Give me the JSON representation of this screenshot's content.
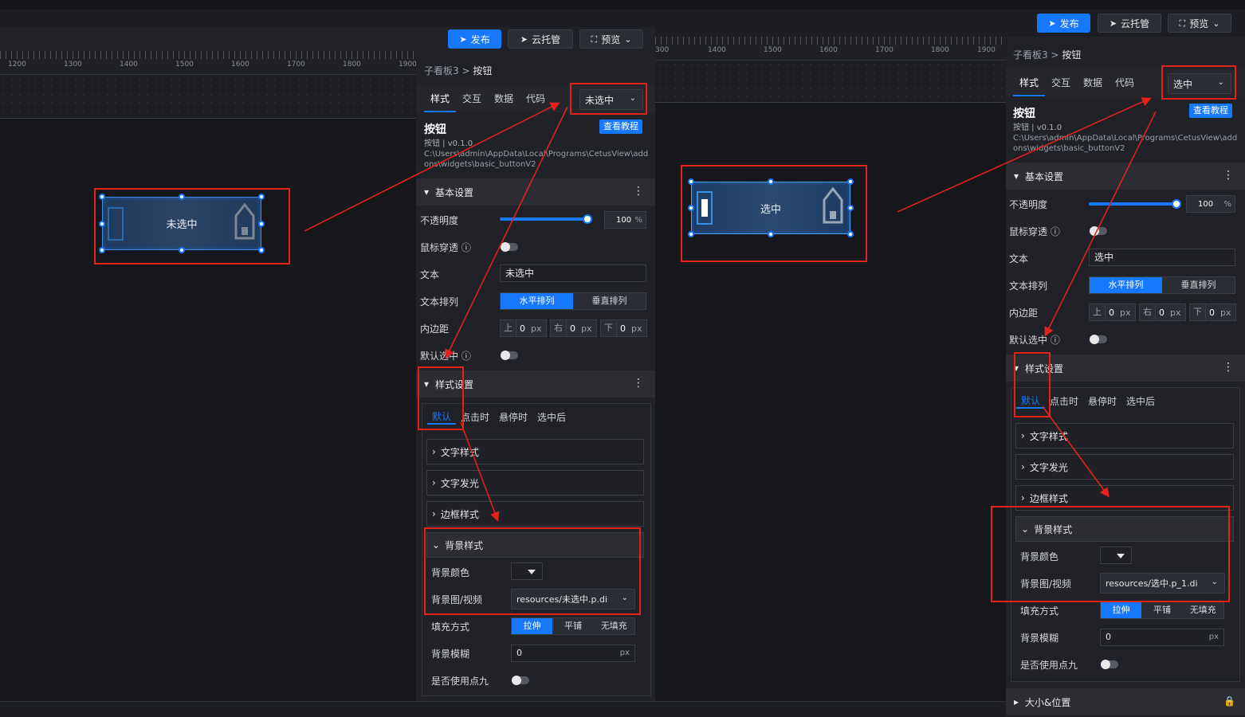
{
  "toolbar": {
    "publish": "发布",
    "cloud_host": "云托管",
    "preview": "预览"
  },
  "ruler_left": [
    "1200",
    "1300",
    "1400",
    "1500",
    "1600",
    "1700",
    "1800",
    "1900"
  ],
  "ruler_right": [
    "300",
    "1400",
    "1500",
    "1600",
    "1700",
    "1800",
    "1900"
  ],
  "canvas": {
    "button_unselected_text": "未选中",
    "button_selected_text": "选中"
  },
  "left_panel": {
    "breadcrumb_parent": "子看板3",
    "breadcrumb_sep": ">",
    "breadcrumb_current": "按钮",
    "tabs": [
      "样式",
      "交互",
      "数据",
      "代码"
    ],
    "state_select": "未选中",
    "widget_title": "按钮",
    "widget_version": "按钮 | v0.1.0",
    "widget_path": "C:\\Users\\admin\\AppData\\Local\\Programs\\CetusView\\addons\\widgets\\basic_buttonV2",
    "tutorial": "查看教程",
    "basic_settings": "基本设置",
    "opacity_label": "不透明度",
    "opacity_value": "100",
    "opacity_unit": "%",
    "mouse_through_label": "鼠标穿透",
    "text_label": "文本",
    "text_value": "未选中",
    "text_layout_label": "文本排列",
    "layout_h": "水平排列",
    "layout_v": "垂直排列",
    "padding_label": "内边距",
    "pad_top": "上",
    "pad_right": "右",
    "pad_bottom": "下",
    "pad_value": "0",
    "pad_unit": "px",
    "default_selected_label": "默认选中",
    "style_settings": "样式设置",
    "state_tabs": [
      "默认",
      "点击时",
      "悬停时",
      "选中后"
    ],
    "text_style": "文字样式",
    "text_glow": "文字发光",
    "border_style": "边框样式",
    "bg_style": "背景样式",
    "bg_color_label": "背景颜色",
    "bg_image_label": "背景图/视频",
    "bg_image_value": "resources/未选中.p.di",
    "fill_label": "填充方式",
    "fill_stretch": "拉伸",
    "fill_tile": "平铺",
    "fill_none": "无填充",
    "blur_label": "背景模糊",
    "blur_value": "0",
    "blur_unit": "px",
    "nine_patch_label": "是否使用点九"
  },
  "right_panel": {
    "breadcrumb_parent": "子看板3",
    "breadcrumb_sep": ">",
    "breadcrumb_current": "按钮",
    "tabs": [
      "样式",
      "交互",
      "数据",
      "代码"
    ],
    "state_select": "选中",
    "widget_title": "按钮",
    "widget_version": "按钮 | v0.1.0",
    "widget_path": "C:\\Users\\admin\\AppData\\Local\\Programs\\CetusView\\addons\\widgets\\basic_buttonV2",
    "tutorial": "查看教程",
    "basic_settings": "基本设置",
    "opacity_label": "不透明度",
    "opacity_value": "100",
    "opacity_unit": "%",
    "mouse_through_label": "鼠标穿透",
    "text_label": "文本",
    "text_value": "选中",
    "text_layout_label": "文本排列",
    "layout_h": "水平排列",
    "layout_v": "垂直排列",
    "padding_label": "内边距",
    "pad_top": "上",
    "pad_right": "右",
    "pad_bottom": "下",
    "pad_value": "0",
    "pad_unit": "px",
    "default_selected_label": "默认选中",
    "style_settings": "样式设置",
    "state_tabs": [
      "默认",
      "点击时",
      "悬停时",
      "选中后"
    ],
    "text_style": "文字样式",
    "text_glow": "文字发光",
    "border_style": "边框样式",
    "bg_style": "背景样式",
    "bg_color_label": "背景颜色",
    "bg_image_label": "背景图/视频",
    "bg_image_value": "resources/选中.p_1.di",
    "fill_label": "填充方式",
    "fill_stretch": "拉伸",
    "fill_tile": "平铺",
    "fill_none": "无填充",
    "blur_label": "背景模糊",
    "blur_value": "0",
    "blur_unit": "px",
    "nine_patch_label": "是否使用点九",
    "size_position": "大小&位置"
  },
  "colors": {
    "accent": "#1677ff",
    "annotation": "#e5211d"
  }
}
